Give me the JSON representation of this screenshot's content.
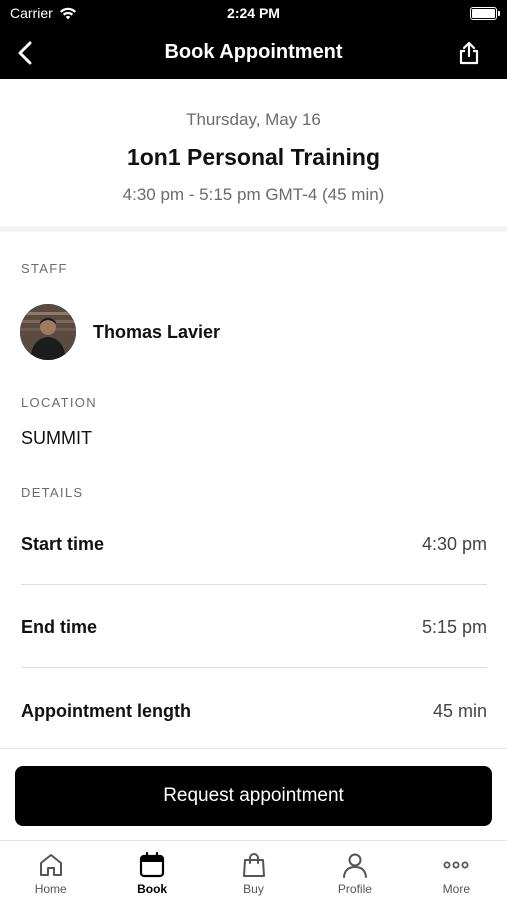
{
  "status_bar": {
    "carrier": "Carrier",
    "time": "2:24 PM"
  },
  "nav": {
    "title": "Book Appointment"
  },
  "appointment": {
    "date": "Thursday, May 16",
    "service": "1on1 Personal Training",
    "time_range": "4:30 pm - 5:15 pm GMT-4 (45 min)"
  },
  "staff": {
    "section_label": "STAFF",
    "name": "Thomas Lavier"
  },
  "location": {
    "section_label": "LOCATION",
    "value": "SUMMIT"
  },
  "details": {
    "section_label": "DETAILS",
    "rows": [
      {
        "label": "Start time",
        "value": "4:30 pm"
      },
      {
        "label": "End time",
        "value": "5:15 pm"
      },
      {
        "label": "Appointment length",
        "value": "45 min"
      }
    ]
  },
  "cta": {
    "label": "Request appointment"
  },
  "tabs": [
    {
      "label": "Home",
      "icon": "home-icon"
    },
    {
      "label": "Book",
      "icon": "calendar-icon",
      "active": true
    },
    {
      "label": "Buy",
      "icon": "shopping-bag-icon"
    },
    {
      "label": "Profile",
      "icon": "person-icon"
    },
    {
      "label": "More",
      "icon": "more-icon"
    }
  ]
}
